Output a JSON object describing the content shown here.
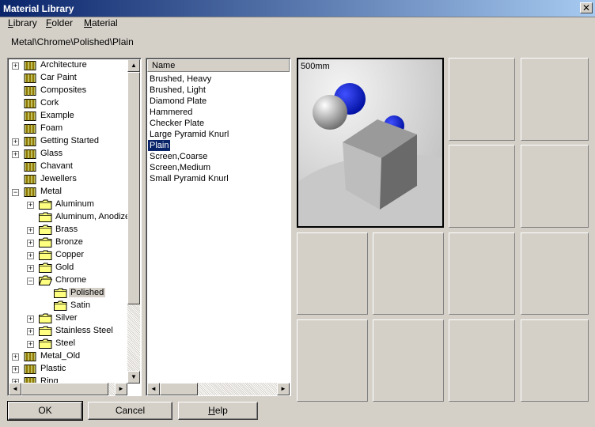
{
  "window": {
    "title": "Material Library",
    "close_glyph": "✕"
  },
  "menu": [
    {
      "label": "Library",
      "accel": "L"
    },
    {
      "label": "Folder",
      "accel": "F"
    },
    {
      "label": "Material",
      "accel": "M"
    }
  ],
  "path": "Metal\\Chrome\\Polished\\Plain",
  "tree": [
    {
      "label": "Architecture",
      "level": 0,
      "expander": "+"
    },
    {
      "label": "Car Paint",
      "level": 0,
      "expander": ""
    },
    {
      "label": "Composites",
      "level": 0,
      "expander": ""
    },
    {
      "label": "Cork",
      "level": 0,
      "expander": ""
    },
    {
      "label": "Example",
      "level": 0,
      "expander": ""
    },
    {
      "label": "Foam",
      "level": 0,
      "expander": ""
    },
    {
      "label": "Getting Started",
      "level": 0,
      "expander": "+"
    },
    {
      "label": "Glass",
      "level": 0,
      "expander": "+"
    },
    {
      "label": "Chavant",
      "level": 0,
      "expander": ""
    },
    {
      "label": "Jewellers",
      "level": 0,
      "expander": ""
    },
    {
      "label": "Metal",
      "level": 0,
      "expander": "−"
    },
    {
      "label": "Aluminum",
      "level": 1,
      "expander": "+"
    },
    {
      "label": "Aluminum, Anodized",
      "level": 1,
      "expander": ""
    },
    {
      "label": "Brass",
      "level": 1,
      "expander": "+"
    },
    {
      "label": "Bronze",
      "level": 1,
      "expander": "+"
    },
    {
      "label": "Copper",
      "level": 1,
      "expander": "+"
    },
    {
      "label": "Gold",
      "level": 1,
      "expander": "+"
    },
    {
      "label": "Chrome",
      "level": 1,
      "expander": "−"
    },
    {
      "label": "Polished",
      "level": 2,
      "expander": "",
      "selected": true
    },
    {
      "label": "Satin",
      "level": 2,
      "expander": ""
    },
    {
      "label": "Silver",
      "level": 1,
      "expander": "+"
    },
    {
      "label": "Stainless Steel",
      "level": 1,
      "expander": "+"
    },
    {
      "label": "Steel",
      "level": 1,
      "expander": "+"
    },
    {
      "label": "Metal_Old",
      "level": 0,
      "expander": "+"
    },
    {
      "label": "Plastic",
      "level": 0,
      "expander": "+"
    },
    {
      "label": "Ring",
      "level": 0,
      "expander": "+"
    }
  ],
  "list": {
    "header": "Name",
    "items": [
      {
        "label": "Brushed, Heavy"
      },
      {
        "label": "Brushed, Light"
      },
      {
        "label": "Diamond Plate"
      },
      {
        "label": "Hammered"
      },
      {
        "label": "Checker Plate"
      },
      {
        "label": "Large Pyramid Knurl"
      },
      {
        "label": "Plain",
        "selected": true
      },
      {
        "label": "Screen,Coarse"
      },
      {
        "label": "Screen,Medium"
      },
      {
        "label": "Small Pyramid Knurl"
      }
    ]
  },
  "preview": {
    "scale_label": "500mm"
  },
  "buttons": {
    "ok": "OK",
    "cancel": "Cancel",
    "help": "Help"
  },
  "scroll_glyphs": {
    "up": "▲",
    "down": "▼",
    "left": "◄",
    "right": "►"
  },
  "colors": {
    "title_start": "#0a246a",
    "title_end": "#a6caf0",
    "selection": "#0a246a",
    "folder": "#ffff80"
  }
}
